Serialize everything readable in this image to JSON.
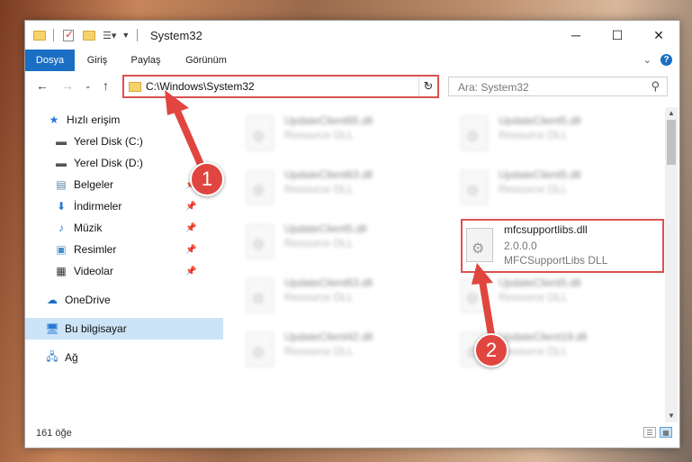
{
  "window": {
    "title": "System32"
  },
  "ribbon": {
    "tabs": [
      {
        "label": "Dosya",
        "active": true
      },
      {
        "label": "Giriş",
        "active": false
      },
      {
        "label": "Paylaş",
        "active": false
      },
      {
        "label": "Görünüm",
        "active": false
      }
    ],
    "help_label": "?"
  },
  "address": {
    "path": "C:\\Windows\\System32"
  },
  "search": {
    "placeholder": "Ara: System32"
  },
  "nav_pane": {
    "items": [
      {
        "label": "Hızlı erişim",
        "icon": "star-icon"
      },
      {
        "label": "Yerel Disk (C:)",
        "icon": "drive-icon"
      },
      {
        "label": "Yerel Disk (D:)",
        "icon": "drive-icon"
      },
      {
        "label": "Belgeler",
        "icon": "document-icon"
      },
      {
        "label": "İndirmeler",
        "icon": "download-icon"
      },
      {
        "label": "Müzik",
        "icon": "music-icon"
      },
      {
        "label": "Resimler",
        "icon": "picture-icon"
      },
      {
        "label": "Videolar",
        "icon": "video-icon"
      },
      {
        "label": "OneDrive",
        "icon": "cloud-icon"
      },
      {
        "label": "Bu bilgisayar",
        "icon": "computer-icon"
      },
      {
        "label": "Ağ",
        "icon": "network-icon"
      }
    ]
  },
  "files": [
    {
      "name": "UpdateClient65.dll",
      "type": "Resource DLL"
    },
    {
      "name": "UpdateClient5.dll",
      "type": "Resource DLL"
    },
    {
      "name": "UpdateClient63.dll",
      "type": "Resource DLL"
    },
    {
      "name": "UpdateClient5.dll",
      "type": "Resource DLL"
    },
    {
      "name": "UpdateClient5.dll",
      "type": "Resource DLL"
    },
    {
      "name": "mfcsupportlibs.dll",
      "version": "2.0.0.0",
      "type": "MFCSupportLibs DLL"
    },
    {
      "name": "UpdateClient63.dll",
      "type": "Resource DLL"
    },
    {
      "name": "UpdateClient5.dll",
      "type": "Resource DLL"
    },
    {
      "name": "UpdateClient42.dll",
      "type": "Resource DLL"
    },
    {
      "name": "UpdateClient19.dll",
      "type": "Resource DLL"
    }
  ],
  "status": {
    "item_count": "161 öğe"
  },
  "annotations": [
    {
      "label": "1"
    },
    {
      "label": "2"
    }
  ],
  "colors": {
    "accent": "#1a6fc4",
    "highlight": "#d9534f",
    "selection": "#cce4f7"
  }
}
